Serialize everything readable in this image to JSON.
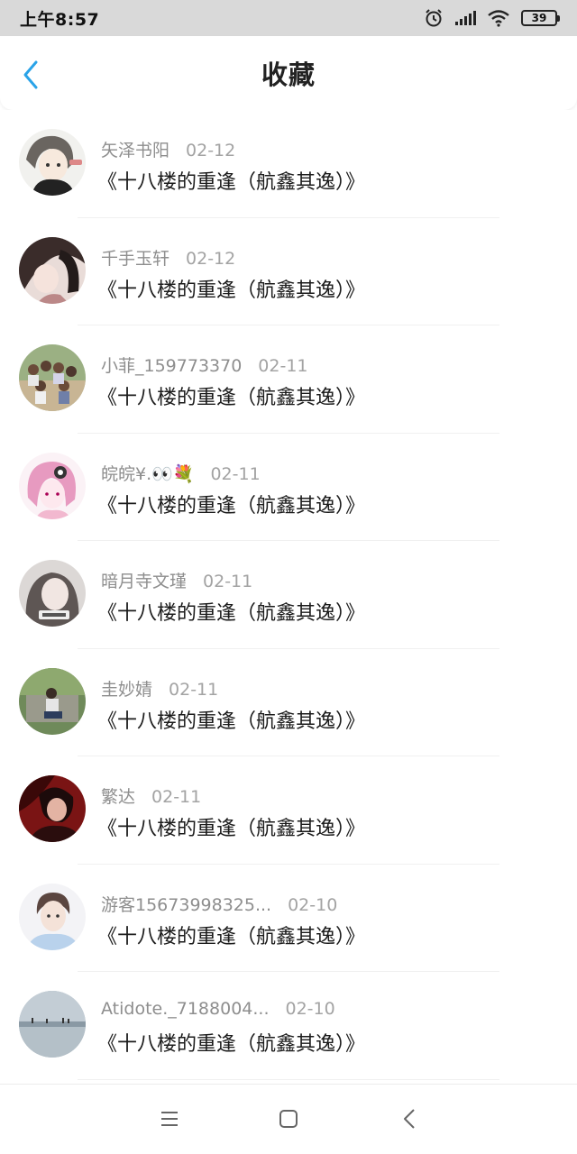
{
  "status_bar": {
    "time": "上午8:57",
    "battery": "39",
    "icons": [
      "alarm-icon",
      "signal-icon",
      "wifi-icon",
      "battery-icon"
    ]
  },
  "header": {
    "title": "收藏",
    "back_icon": "chevron-left-icon",
    "accent_color": "#2aa3e8"
  },
  "items": [
    {
      "user": "矢泽书阳",
      "date": "02-12",
      "title": "《十八楼的重逢（航鑫其逸）》",
      "avatar": "avatar-1"
    },
    {
      "user": "千手玉轩",
      "date": "02-12",
      "title": "《十八楼的重逢（航鑫其逸）》",
      "avatar": "avatar-2"
    },
    {
      "user": "小菲_159773370",
      "date": "02-11",
      "title": "《十八楼的重逢（航鑫其逸）》",
      "avatar": "avatar-3"
    },
    {
      "user": "皖皖¥.👀💐",
      "date": "02-11",
      "title": "《十八楼的重逢（航鑫其逸）》",
      "avatar": "avatar-4"
    },
    {
      "user": "暗月寺文瑾",
      "date": "02-11",
      "title": "《十八楼的重逢（航鑫其逸）》",
      "avatar": "avatar-5"
    },
    {
      "user": "圭妙婧",
      "date": "02-11",
      "title": "《十八楼的重逢（航鑫其逸）》",
      "avatar": "avatar-6"
    },
    {
      "user": "繁达",
      "date": "02-11",
      "title": "《十八楼的重逢（航鑫其逸）》",
      "avatar": "avatar-7"
    },
    {
      "user": "游客15673998325...",
      "date": "02-10",
      "title": "《十八楼的重逢（航鑫其逸）》",
      "avatar": "avatar-8"
    },
    {
      "user": "Atidote._7188004...",
      "date": "02-10",
      "title": "《十八楼的重逢（航鑫其逸）》",
      "avatar": "avatar-9"
    }
  ],
  "nav_bar": {
    "icons": [
      "menu-icon",
      "home-square-icon",
      "back-triangle-icon"
    ]
  }
}
